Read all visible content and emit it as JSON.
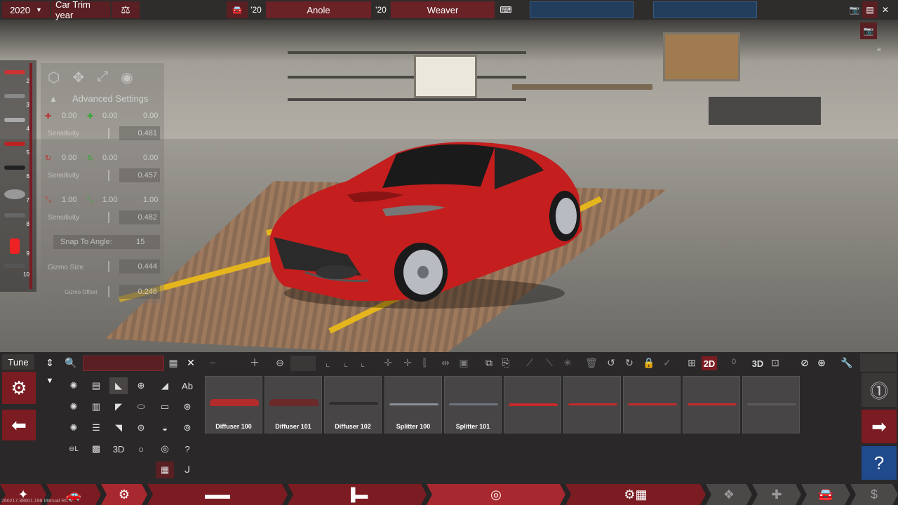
{
  "topbar": {
    "year": "2020",
    "year_caret": "▼",
    "year_label": "Car Trim year",
    "model_year": "'20",
    "model_name": "Anole",
    "trim_year": "'20",
    "trim_name": "Weaver"
  },
  "rail": {
    "numbers": [
      "2",
      "3",
      "4",
      "5",
      "6",
      "7",
      "8",
      "9",
      "10"
    ]
  },
  "advanced": {
    "title": "Advanced Settings",
    "pos_x": "0.00",
    "pos_y": "0.00",
    "pos_z": "0.00",
    "pos_sensitivity_label": "Sensitivity",
    "pos_sensitivity": "0.481",
    "rot_x": "0.00",
    "rot_y": "0.00",
    "rot_z": "0.00",
    "rot_sensitivity_label": "Sensitivity",
    "rot_sensitivity": "0.457",
    "scale_x": "1.00",
    "scale_y": "1.00",
    "scale_z": "1.00",
    "scale_sensitivity_label": "Sensitivity",
    "scale_sensitivity": "0.482",
    "snap_label": "Snap To Angle:",
    "snap_value": "15",
    "gizmo_size_label": "Gizmo Size",
    "gizmo_size": "0.444",
    "gizmo_offset_label": "Gizmo Offset",
    "gizmo_offset": "0.246"
  },
  "toolbar": {
    "tune_label": "Tune",
    "search_value": "",
    "mode_2d": "2D",
    "mode_3d": "3D",
    "counter": "0"
  },
  "categories": {
    "ab_label": "Ab",
    "el_label": "⊖L",
    "threed_label": "3D"
  },
  "parts": [
    {
      "label": "Diffuser 100",
      "color": "#b32b2b"
    },
    {
      "label": "Diffuser 101",
      "color": "#6a2a2a"
    },
    {
      "label": "Diffuser 102",
      "color": "#2e2e2e"
    },
    {
      "label": "Splitter 100",
      "color": "#8a8f9a"
    },
    {
      "label": "Splitter 101",
      "color": "#6d7480"
    },
    {
      "label": "",
      "color": "#c32a2a"
    },
    {
      "label": "",
      "color": "#c32a2a"
    },
    {
      "label": "",
      "color": "#c32a2a"
    },
    {
      "label": "",
      "color": "#c32a2a"
    },
    {
      "label": "",
      "color": "#5b5b5b"
    }
  ],
  "build_id": "260217.38601.198 Manual RC V.",
  "colors": {
    "accent_red": "#7a1c22",
    "panel_dark": "#2a2828",
    "help_blue": "#1f4a8c",
    "car_red": "#c41e1e"
  },
  "icons": [
    "gear-icon",
    "arrow-left-icon",
    "arrow-right-icon",
    "help-icon",
    "alert-icon",
    "camera-icon",
    "search-icon",
    "wrench-icon"
  ]
}
